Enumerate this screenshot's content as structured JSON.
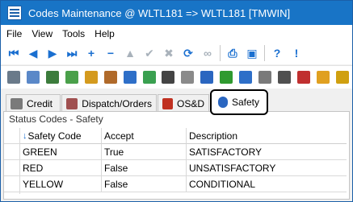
{
  "window": {
    "title": "Codes Maintenance @ WLTL181 => WLTL181 [TMWIN]"
  },
  "menu": [
    "File",
    "View",
    "Tools",
    "Help"
  ],
  "toolbar1": [
    {
      "icon": "first-record-icon",
      "glyph": "⏮"
    },
    {
      "icon": "previous-record-icon",
      "glyph": "◀"
    },
    {
      "icon": "next-record-icon",
      "glyph": "▶"
    },
    {
      "icon": "last-record-icon",
      "glyph": "⏭"
    },
    {
      "icon": "add-icon",
      "glyph": "+"
    },
    {
      "icon": "remove-icon",
      "glyph": "−"
    },
    {
      "icon": "move-up-icon",
      "glyph": "▲"
    },
    {
      "icon": "confirm-icon",
      "glyph": "✔"
    },
    {
      "icon": "cancel-icon",
      "glyph": "✖"
    },
    {
      "icon": "refresh-icon",
      "glyph": "⟳"
    },
    {
      "icon": "link-icon",
      "glyph": "∞"
    },
    {
      "icon": "print-icon",
      "glyph": "⎙"
    },
    {
      "icon": "monitor-icon",
      "glyph": "▣"
    },
    {
      "icon": "help-icon",
      "glyph": "?"
    },
    {
      "icon": "info-icon",
      "glyph": "!"
    }
  ],
  "toolbar2": [
    {
      "icon": "percent-icon",
      "color": "#6a7a8a"
    },
    {
      "icon": "notes-icon",
      "color": "#5a88c8"
    },
    {
      "icon": "checklist-icon",
      "color": "#3c7c3c"
    },
    {
      "icon": "chart-icon",
      "color": "#4aa04a"
    },
    {
      "icon": "package-icon",
      "color": "#d49a1e"
    },
    {
      "icon": "box-icon",
      "color": "#b06a2a"
    },
    {
      "icon": "flag-blue-icon",
      "color": "#2e6fc8"
    },
    {
      "icon": "network-icon",
      "color": "#3aa050"
    },
    {
      "icon": "worker-icon",
      "color": "#444444"
    },
    {
      "icon": "gauge-icon",
      "color": "#8a8a8a"
    },
    {
      "icon": "user-icon",
      "color": "#2a66c0"
    },
    {
      "icon": "flag-green-icon",
      "color": "#2f9a2f"
    },
    {
      "icon": "flag-blue-icon",
      "color": "#2e6fc8"
    },
    {
      "icon": "tools-icon",
      "color": "#7a7a7a"
    },
    {
      "icon": "camera-icon",
      "color": "#505050"
    },
    {
      "icon": "gift-icon",
      "color": "#c03030"
    },
    {
      "icon": "sun-icon",
      "color": "#e0a020"
    },
    {
      "icon": "flag-yellow-icon",
      "color": "#d0a010"
    }
  ],
  "tabs": [
    {
      "label": "Credit",
      "icon": "credit-icon",
      "color": "#7a7a7a",
      "active": false
    },
    {
      "label": "Dispatch/Orders",
      "icon": "dispatch-icon",
      "color": "#a05050",
      "active": false
    },
    {
      "label": "OS&D",
      "icon": "osd-icon",
      "color": "#c03020",
      "active": false
    },
    {
      "label": "Safety",
      "icon": "safety-icon",
      "color": "#2a66c0",
      "active": true
    }
  ],
  "panel": {
    "title": "Status Codes - Safety"
  },
  "table": {
    "columns": [
      "Safety Code",
      "Accept",
      "Description"
    ],
    "sort_indicator": "↓",
    "rows": [
      [
        "GREEN",
        "True",
        "SATISFACTORY"
      ],
      [
        "RED",
        "False",
        "UNSATISFACTORY"
      ],
      [
        "YELLOW",
        "False",
        "CONDITIONAL"
      ]
    ]
  }
}
